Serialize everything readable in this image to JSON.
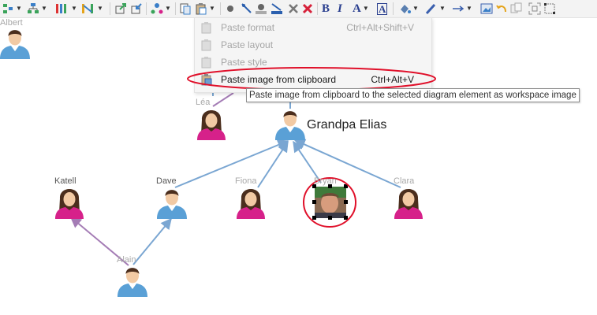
{
  "toolbar": {
    "items": [
      "layout-icon",
      "hierarchy-icon",
      "columns-icon",
      "chart-icon",
      "export-icon",
      "import-icon",
      "org-chart-icon",
      "copy-icon",
      "paste-icon",
      "node-icon",
      "link-icon",
      "label-node-icon",
      "label-link-icon",
      "delete-icon",
      "delete-all-icon",
      "fill-icon",
      "pen-icon",
      "arrow-icon",
      "image-icon",
      "undo-icon",
      "copy-style-icon",
      "zoom-fit-icon",
      "select-icon"
    ],
    "bold": "B",
    "italic": "I",
    "font_color": "A",
    "font_style": "A"
  },
  "context_menu": {
    "items": [
      {
        "label": "Paste format",
        "shortcut": "Ctrl+Alt+Shift+V",
        "enabled": false
      },
      {
        "label": "Paste layout",
        "shortcut": "",
        "enabled": false
      },
      {
        "label": "Paste style",
        "shortcut": "",
        "enabled": false
      },
      {
        "label": "Paste image from clipboard",
        "shortcut": "Ctrl+Alt+V",
        "enabled": true
      }
    ]
  },
  "tooltip": "Paste image from clipboard to the selected diagram element as workspace image",
  "diagram": {
    "people": {
      "albert": {
        "name": "Albert",
        "gender": "male"
      },
      "lea": {
        "name": "Léa",
        "gender": "female"
      },
      "grandpa_elias": {
        "name": "Grandpa Elias",
        "gender": "male"
      },
      "katell": {
        "name": "Katell",
        "gender": "female"
      },
      "dave": {
        "name": "Dave",
        "gender": "male"
      },
      "fiona": {
        "name": "Fiona",
        "gender": "female"
      },
      "bryan": {
        "name": "Bryan",
        "gender": "male",
        "photo": true,
        "selected": true
      },
      "clara": {
        "name": "Clara",
        "gender": "female"
      },
      "alain": {
        "name": "Alain",
        "gender": "male"
      }
    },
    "colors": {
      "male_shirt": "#5aa0d6",
      "female_top": "#d6218a",
      "link_blue": "#7aa6d2",
      "link_purple": "#a47cb5",
      "highlight": "#e0102a"
    }
  }
}
